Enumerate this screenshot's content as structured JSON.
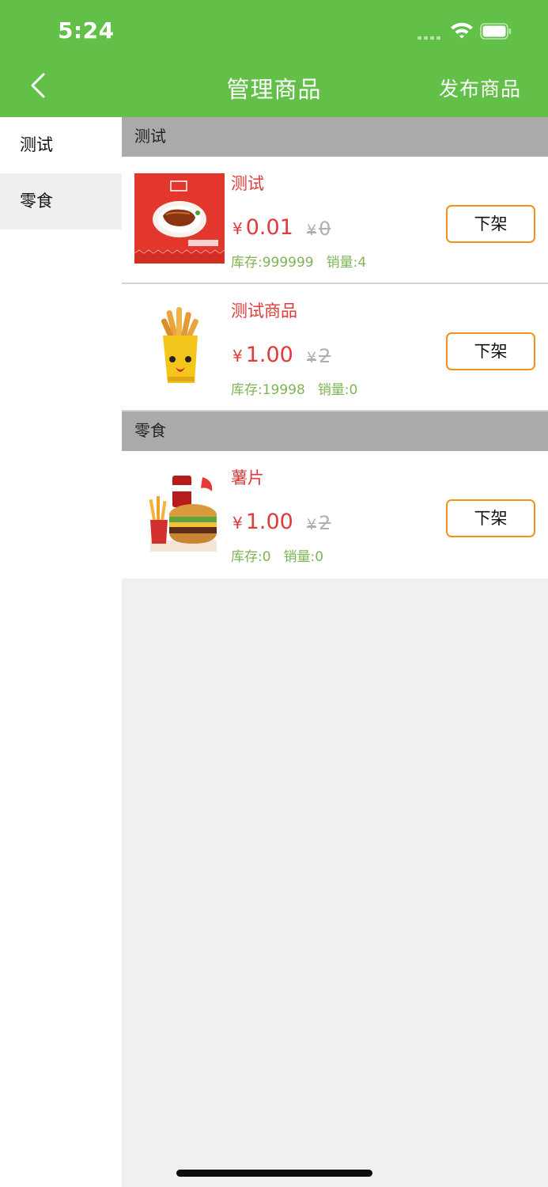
{
  "status_bar": {
    "time": "5:24"
  },
  "nav": {
    "title": "管理商品",
    "publish_label": "发布商品"
  },
  "sidebar": {
    "items": [
      {
        "label": "测试"
      },
      {
        "label": "零食"
      }
    ]
  },
  "sections": [
    {
      "title": "测试",
      "products": [
        {
          "name": "测试",
          "currency": "¥",
          "price": "0.01",
          "original_price": "0",
          "stock_label": "库存:999999",
          "sales_label": "销量:4",
          "action_label": "下架"
        },
        {
          "name": "测试商品",
          "currency": "¥",
          "price": "1.00",
          "original_price": "2",
          "stock_label": "库存:19998",
          "sales_label": "销量:0",
          "action_label": "下架"
        }
      ]
    },
    {
      "title": "零食",
      "products": [
        {
          "name": "薯片",
          "currency": "¥",
          "price": "1.00",
          "original_price": "2",
          "stock_label": "库存:0",
          "sales_label": "销量:0",
          "action_label": "下架"
        }
      ]
    }
  ],
  "colors": {
    "header_green": "#62bf47",
    "price_red": "#e03a3a",
    "meta_green": "#7fb455",
    "button_orange": "#f0931b",
    "section_gray": "#aaaaaa"
  }
}
